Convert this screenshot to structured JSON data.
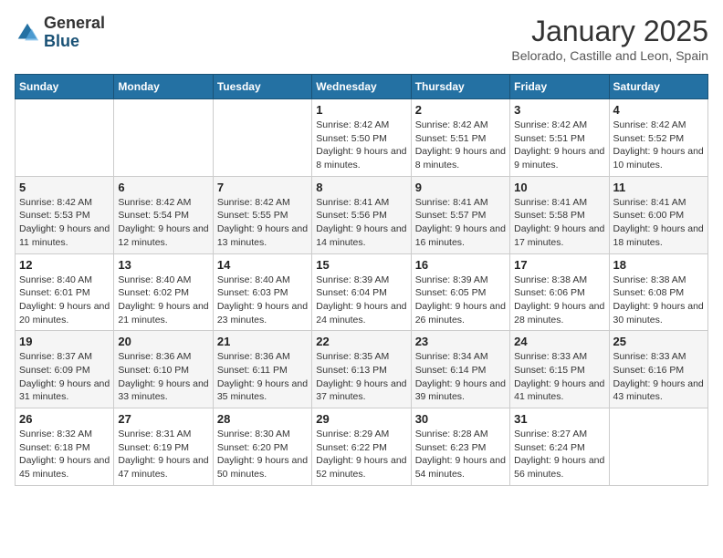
{
  "header": {
    "logo_general": "General",
    "logo_blue": "Blue",
    "month_title": "January 2025",
    "subtitle": "Belorado, Castille and Leon, Spain"
  },
  "weekdays": [
    "Sunday",
    "Monday",
    "Tuesday",
    "Wednesday",
    "Thursday",
    "Friday",
    "Saturday"
  ],
  "weeks": [
    [
      {
        "day": "",
        "info": ""
      },
      {
        "day": "",
        "info": ""
      },
      {
        "day": "",
        "info": ""
      },
      {
        "day": "1",
        "info": "Sunrise: 8:42 AM\nSunset: 5:50 PM\nDaylight: 9 hours and 8 minutes."
      },
      {
        "day": "2",
        "info": "Sunrise: 8:42 AM\nSunset: 5:51 PM\nDaylight: 9 hours and 8 minutes."
      },
      {
        "day": "3",
        "info": "Sunrise: 8:42 AM\nSunset: 5:51 PM\nDaylight: 9 hours and 9 minutes."
      },
      {
        "day": "4",
        "info": "Sunrise: 8:42 AM\nSunset: 5:52 PM\nDaylight: 9 hours and 10 minutes."
      }
    ],
    [
      {
        "day": "5",
        "info": "Sunrise: 8:42 AM\nSunset: 5:53 PM\nDaylight: 9 hours and 11 minutes."
      },
      {
        "day": "6",
        "info": "Sunrise: 8:42 AM\nSunset: 5:54 PM\nDaylight: 9 hours and 12 minutes."
      },
      {
        "day": "7",
        "info": "Sunrise: 8:42 AM\nSunset: 5:55 PM\nDaylight: 9 hours and 13 minutes."
      },
      {
        "day": "8",
        "info": "Sunrise: 8:41 AM\nSunset: 5:56 PM\nDaylight: 9 hours and 14 minutes."
      },
      {
        "day": "9",
        "info": "Sunrise: 8:41 AM\nSunset: 5:57 PM\nDaylight: 9 hours and 16 minutes."
      },
      {
        "day": "10",
        "info": "Sunrise: 8:41 AM\nSunset: 5:58 PM\nDaylight: 9 hours and 17 minutes."
      },
      {
        "day": "11",
        "info": "Sunrise: 8:41 AM\nSunset: 6:00 PM\nDaylight: 9 hours and 18 minutes."
      }
    ],
    [
      {
        "day": "12",
        "info": "Sunrise: 8:40 AM\nSunset: 6:01 PM\nDaylight: 9 hours and 20 minutes."
      },
      {
        "day": "13",
        "info": "Sunrise: 8:40 AM\nSunset: 6:02 PM\nDaylight: 9 hours and 21 minutes."
      },
      {
        "day": "14",
        "info": "Sunrise: 8:40 AM\nSunset: 6:03 PM\nDaylight: 9 hours and 23 minutes."
      },
      {
        "day": "15",
        "info": "Sunrise: 8:39 AM\nSunset: 6:04 PM\nDaylight: 9 hours and 24 minutes."
      },
      {
        "day": "16",
        "info": "Sunrise: 8:39 AM\nSunset: 6:05 PM\nDaylight: 9 hours and 26 minutes."
      },
      {
        "day": "17",
        "info": "Sunrise: 8:38 AM\nSunset: 6:06 PM\nDaylight: 9 hours and 28 minutes."
      },
      {
        "day": "18",
        "info": "Sunrise: 8:38 AM\nSunset: 6:08 PM\nDaylight: 9 hours and 30 minutes."
      }
    ],
    [
      {
        "day": "19",
        "info": "Sunrise: 8:37 AM\nSunset: 6:09 PM\nDaylight: 9 hours and 31 minutes."
      },
      {
        "day": "20",
        "info": "Sunrise: 8:36 AM\nSunset: 6:10 PM\nDaylight: 9 hours and 33 minutes."
      },
      {
        "day": "21",
        "info": "Sunrise: 8:36 AM\nSunset: 6:11 PM\nDaylight: 9 hours and 35 minutes."
      },
      {
        "day": "22",
        "info": "Sunrise: 8:35 AM\nSunset: 6:13 PM\nDaylight: 9 hours and 37 minutes."
      },
      {
        "day": "23",
        "info": "Sunrise: 8:34 AM\nSunset: 6:14 PM\nDaylight: 9 hours and 39 minutes."
      },
      {
        "day": "24",
        "info": "Sunrise: 8:33 AM\nSunset: 6:15 PM\nDaylight: 9 hours and 41 minutes."
      },
      {
        "day": "25",
        "info": "Sunrise: 8:33 AM\nSunset: 6:16 PM\nDaylight: 9 hours and 43 minutes."
      }
    ],
    [
      {
        "day": "26",
        "info": "Sunrise: 8:32 AM\nSunset: 6:18 PM\nDaylight: 9 hours and 45 minutes."
      },
      {
        "day": "27",
        "info": "Sunrise: 8:31 AM\nSunset: 6:19 PM\nDaylight: 9 hours and 47 minutes."
      },
      {
        "day": "28",
        "info": "Sunrise: 8:30 AM\nSunset: 6:20 PM\nDaylight: 9 hours and 50 minutes."
      },
      {
        "day": "29",
        "info": "Sunrise: 8:29 AM\nSunset: 6:22 PM\nDaylight: 9 hours and 52 minutes."
      },
      {
        "day": "30",
        "info": "Sunrise: 8:28 AM\nSunset: 6:23 PM\nDaylight: 9 hours and 54 minutes."
      },
      {
        "day": "31",
        "info": "Sunrise: 8:27 AM\nSunset: 6:24 PM\nDaylight: 9 hours and 56 minutes."
      },
      {
        "day": "",
        "info": ""
      }
    ]
  ]
}
